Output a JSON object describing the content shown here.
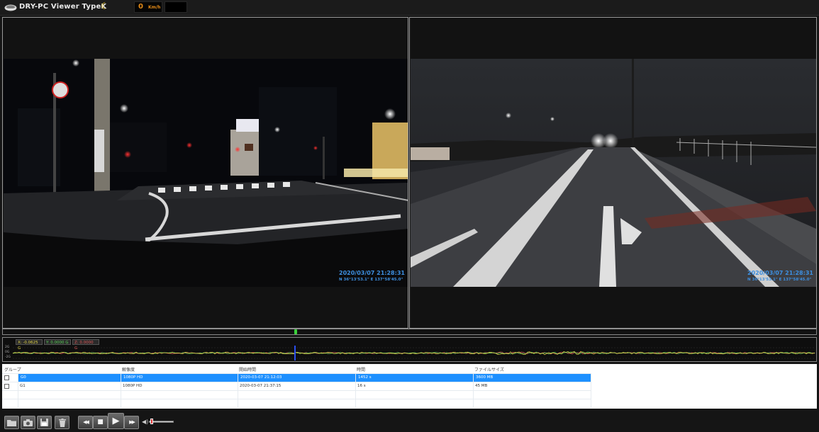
{
  "app": {
    "title": "DRY-PC Viewer TypeK",
    "speed_value": "0",
    "speed_unit": "Km/h"
  },
  "front_camera": {
    "timestamp": "2020/03/07 21:28:31",
    "gps": "N 36°13'53.1\"  E 137°58'45.0\""
  },
  "rear_camera": {
    "timestamp": "2020/03/07 21:28:31",
    "gps": "N 36°13'53.1\"  E 137°58'45.0\""
  },
  "seekbar": {
    "progress": 0.36
  },
  "gsensor": {
    "x_label": "X: -0.0625 G",
    "y_label": "Y: 0.0000 G",
    "z_label": "Z: 0.0000 G",
    "axis_top": "2G",
    "axis_mid": "0G",
    "axis_bottom": "-2G",
    "x_color": "#e6d84a",
    "y_color": "#5ad35a",
    "z_color": "#e05a5a"
  },
  "file_table": {
    "columns": [
      "グループ",
      "解像度",
      "開始時間",
      "時間",
      "ファイルサイズ"
    ],
    "rows": [
      {
        "group": "G0",
        "resolution": "1080P HD",
        "start": "2020-03-07 21:12:03",
        "duration": "1452 s",
        "size": "3600 MB",
        "selected": true
      },
      {
        "group": "G1",
        "resolution": "1080P HD",
        "start": "2020-03-07 21:37:15",
        "duration": "16 s",
        "size": "45 MB",
        "selected": false
      }
    ]
  },
  "toolbar": {
    "folder_icon": "folder-icon",
    "snapshot_icon": "camera-icon",
    "save_icon": "save-icon",
    "delete_icon": "trash-icon",
    "rewind_glyph": "◀◀",
    "stop_glyph": "■",
    "play_glyph": "▶",
    "forward_glyph": "▶▶",
    "volume_glyph": "◀)",
    "volume_level": 0.05
  }
}
